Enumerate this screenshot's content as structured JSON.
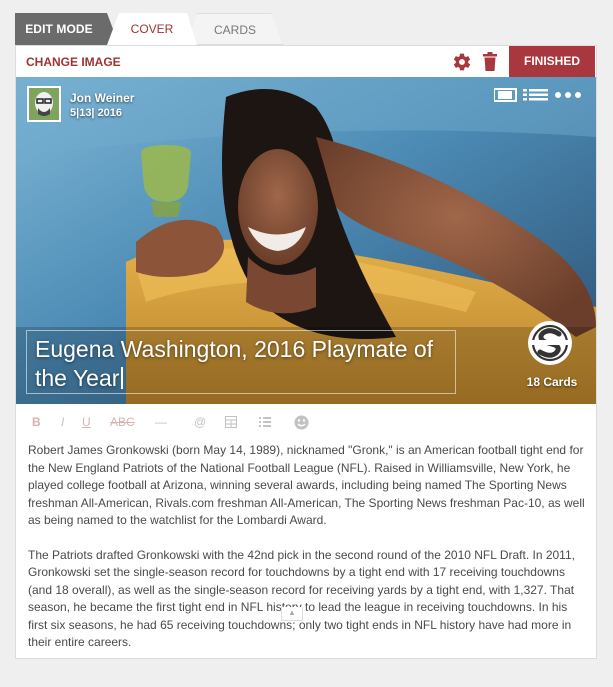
{
  "tabs": {
    "edit_mode": "EDIT MODE",
    "cover": "COVER",
    "cards": "CARDS"
  },
  "toolbar": {
    "change_image": "CHANGE IMAGE",
    "settings_icon": "gear-icon",
    "delete_icon": "trash-icon",
    "finished": "FINISHED"
  },
  "cover": {
    "author_name": "Jon Weiner",
    "date": "5|13| 2016",
    "title": "Eugena Washington, 2016 Playmate of the Year",
    "cards_count": "18 Cards",
    "brand_logo": "sportingnews-logo"
  },
  "format_bar": {
    "bold": "B",
    "italic": "I",
    "underline": "U",
    "strikethrough": "ABC",
    "horizontal_rule": "—",
    "mention": "@",
    "table_icon": "table-icon",
    "list_icon": "list-icon",
    "emoji_icon": "smiley-icon"
  },
  "body": {
    "paragraph_1": "Robert James Gronkowski (born May 14, 1989), nicknamed \"Gronk,\" is an American football tight end for the New England Patriots of the National Football League (NFL). Raised in Williamsville, New York, he played college football at Arizona, winning several awards, including being named The Sporting News freshman All-American, Rivals.com freshman All-American, The Sporting News freshman Pac-10, as well as being named to the watchlist for the Lombardi Award.",
    "paragraph_2": "The Patriots drafted Gronkowski with the 42nd pick in the second round of the 2010 NFL Draft. In 2011, Gronkowski set the single-season record for touchdowns by a tight end with 17 receiving touchdowns (and 18 overall), as well as the single-season record for receiving yards by a tight end, with 1,327. That season, he became the first tight end in NFL history to lead the league in receiving touchdowns. In his first six seasons, he had 65 receiving touchdowns; only two tight ends in NFL history have had more in their entire careers."
  },
  "colors": {
    "accent": "#a8383e",
    "tab_dark": "#6b6b6b"
  }
}
